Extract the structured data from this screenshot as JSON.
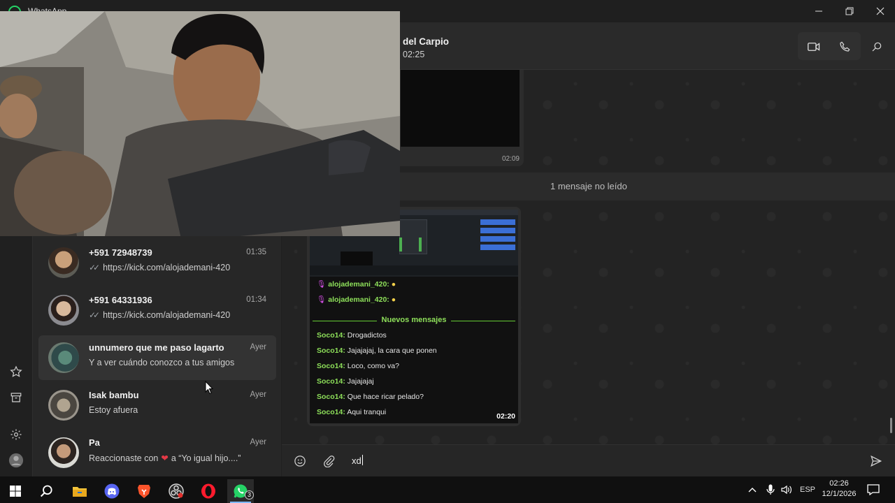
{
  "window": {
    "title": "WhatsApp",
    "controls": [
      "minimize",
      "restore",
      "close"
    ]
  },
  "conversation": {
    "name": "del Carpio",
    "status": "02:25",
    "first_bubble_time": "02:09",
    "unread_label": "1 mensaje no leído",
    "media_time": "02:20",
    "compose_text": "xd",
    "embedded_chat": [
      {
        "user": "alojademani_420:",
        "text": ""
      },
      {
        "user": "alojademani_420:",
        "text": ""
      },
      {
        "separator": "Nuevos mensajes"
      },
      {
        "user": "Soco14:",
        "text": "Drogadictos"
      },
      {
        "user": "Soco14:",
        "text": "Jajajajaj, la cara que ponen"
      },
      {
        "user": "Soco14:",
        "text": "Loco, como va?"
      },
      {
        "user": "Soco14:",
        "text": "Jajajajaj"
      },
      {
        "user": "Soco14:",
        "text": "Que hace ricar pelado?"
      },
      {
        "user": "Soco14:",
        "text": "Aqui tranqui"
      }
    ]
  },
  "chats": [
    {
      "name": "+591 72948739",
      "time": "01:35",
      "preview": "https://kick.com/alojademani-420",
      "ticks": "✓✓"
    },
    {
      "name": "+591 64331936",
      "time": "01:34",
      "preview": "https://kick.com/alojademani-420",
      "ticks": "✓✓"
    },
    {
      "name": "unnumero que me paso lagarto",
      "time": "Ayer",
      "preview": "Y a ver cuándo conozco a tus amigos"
    },
    {
      "name": "Isak bambu",
      "time": "Ayer",
      "preview": "Estoy afuera"
    },
    {
      "name": "Pa",
      "time": "Ayer",
      "preview_before": "Reaccionaste con",
      "preview_heart": "❤",
      "preview_after": "a “Yo igual hijo....”"
    }
  ],
  "rail_icons": [
    "star-icon",
    "archive-icon",
    "settings-icon",
    "profile-icon"
  ],
  "taskbar": {
    "apps": [
      "windows-start",
      "search",
      "file-explorer",
      "discord",
      "brave",
      "obs",
      "opera",
      "whatsapp"
    ],
    "whatsapp_badge": "3",
    "language": "ESP",
    "time": "02:26",
    "date": "12/1/2026"
  }
}
